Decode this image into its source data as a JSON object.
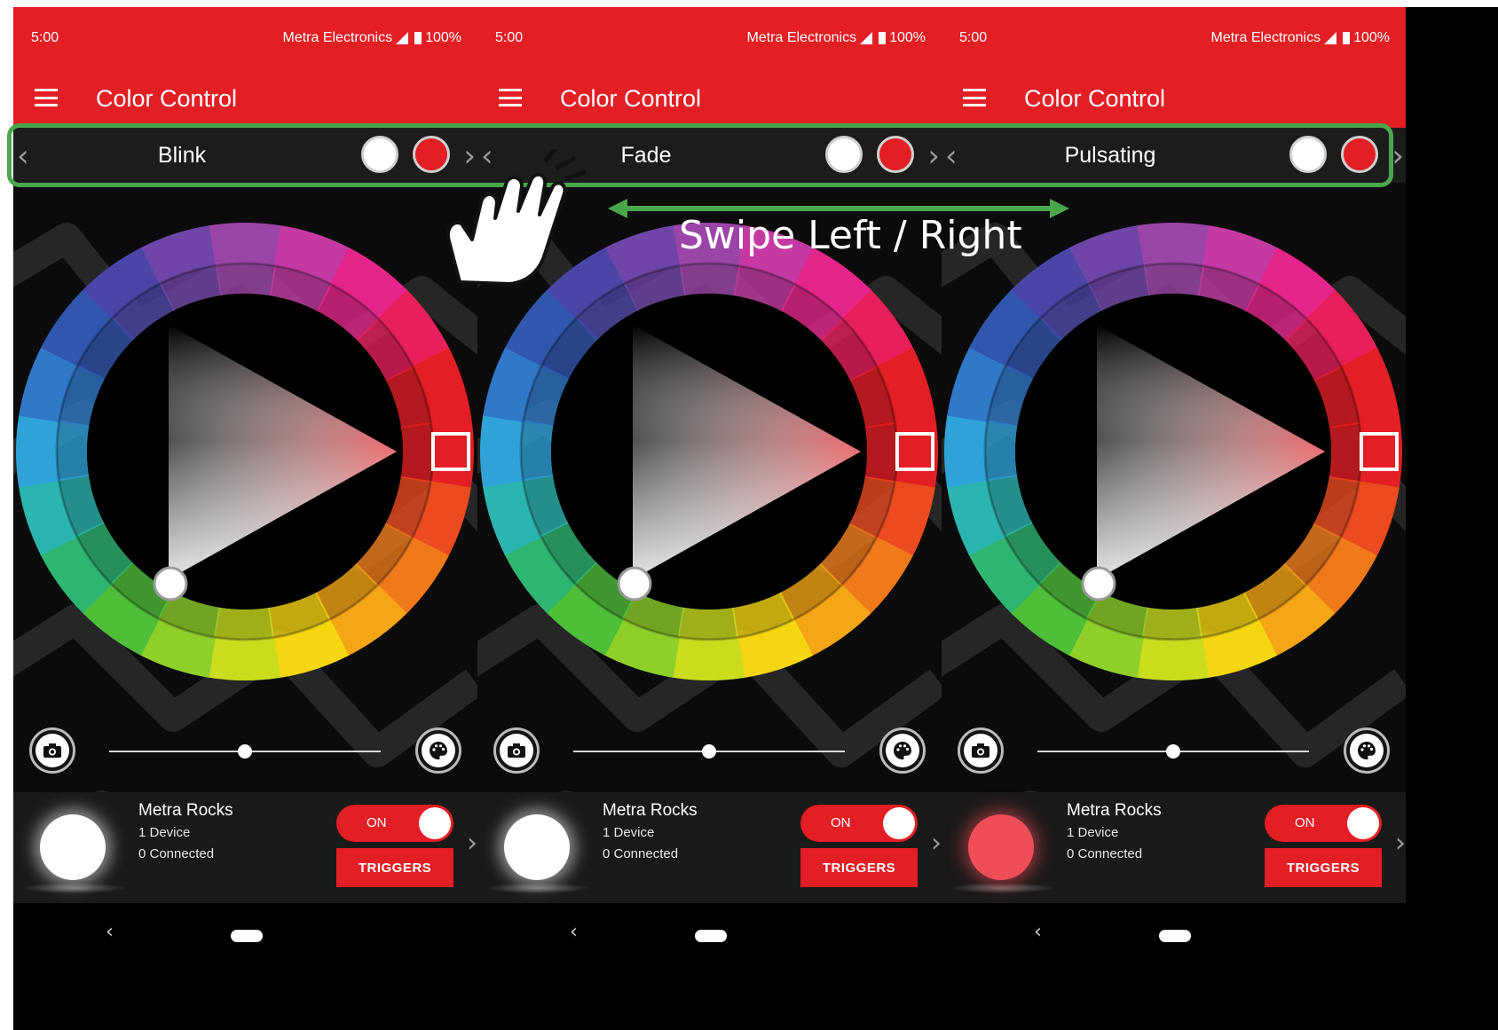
{
  "colors": {
    "accent": "#e31e24",
    "highlight": "#4aa64d",
    "bar": "#1c1c1c"
  },
  "gesture": {
    "hint": "Swipe Left / Right",
    "icon": "hand-swipe-icon"
  },
  "screens": [
    {
      "status": {
        "time": "5:00",
        "carrier": "Metra Electronics",
        "battery": "100%"
      },
      "title": "Color Control",
      "effect": "Blink",
      "brightness": 0.5,
      "device": {
        "name": "Metra Rocks",
        "count": "1 Device",
        "connected": "0 Connected",
        "toggle": "ON",
        "triggers": "TRIGGERS",
        "glow": "white"
      }
    },
    {
      "status": {
        "time": "5:00",
        "carrier": "Metra Electronics",
        "battery": "100%"
      },
      "title": "Color Control",
      "effect": "Fade",
      "brightness": 0.5,
      "device": {
        "name": "Metra Rocks",
        "count": "1 Device",
        "connected": "0 Connected",
        "toggle": "ON",
        "triggers": "TRIGGERS",
        "glow": "white"
      }
    },
    {
      "status": {
        "time": "5:00",
        "carrier": "Metra Electronics",
        "battery": "100%"
      },
      "title": "Color Control",
      "effect": "Pulsating",
      "brightness": 0.5,
      "device": {
        "name": "Metra Rocks",
        "count": "1 Device",
        "connected": "0 Connected",
        "toggle": "ON",
        "triggers": "TRIGGERS",
        "glow": "red"
      }
    }
  ]
}
